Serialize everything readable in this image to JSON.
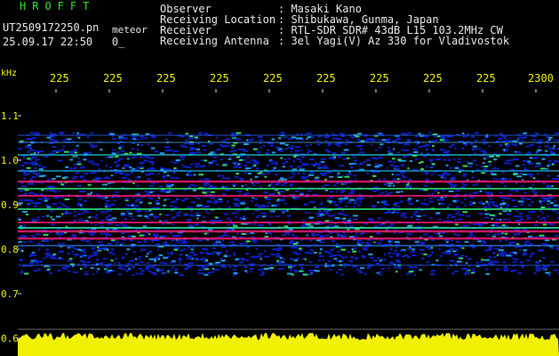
{
  "header": {
    "brand": "HROFFT",
    "filename": "UT2509172250.pn",
    "subtitle": "meteor",
    "datetime": "25.09.17 22:50",
    "counter": "0",
    "fields": [
      {
        "label": "Observer",
        "value": ": Masaki Kano"
      },
      {
        "label": "Receiving Location",
        "value": ": Shibukawa, Gunma, Japan"
      },
      {
        "label": "Receiver",
        "value": ": RTL-SDR SDR# 43dB L15 103.2MHz CW"
      },
      {
        "label": "Receiving Antenna",
        "value": ": 3el Yagi(V) Az 330 for Vladivostok"
      }
    ]
  },
  "axis": {
    "unit": "kHz",
    "x_ticks": [
      "225",
      "225",
      "225",
      "225",
      "225",
      "225",
      "225",
      "225",
      "225",
      "2300"
    ],
    "y_ticks": [
      "1.1",
      "1.0",
      "0.9",
      "0.8",
      "0.7",
      "0.6"
    ]
  },
  "colors": {
    "green": "#22e822",
    "yellow": "#f0f000",
    "blue": "#0018d8",
    "red": "#e81a70"
  }
}
